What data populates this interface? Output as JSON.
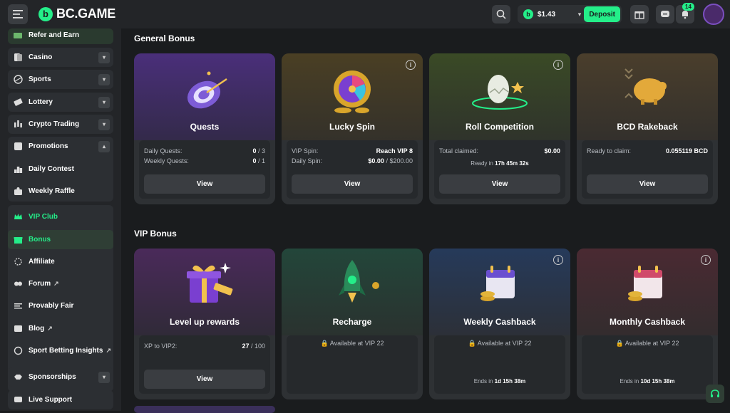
{
  "brand": {
    "name": "BC.GAME"
  },
  "header": {
    "balance": "$1.43",
    "deposit_label": "Deposit",
    "notif_count": "14"
  },
  "sidebar": {
    "items": [
      {
        "label": "Refer and Earn"
      },
      {
        "label": "Casino"
      },
      {
        "label": "Sports"
      },
      {
        "label": "Lottery"
      },
      {
        "label": "Crypto Trading"
      },
      {
        "label": "Promotions"
      },
      {
        "label": "Daily Contest"
      },
      {
        "label": "Weekly Raffle"
      },
      {
        "label": "VIP Club"
      },
      {
        "label": "Bonus"
      },
      {
        "label": "Affiliate"
      },
      {
        "label": "Forum"
      },
      {
        "label": "Provably Fair"
      },
      {
        "label": "Blog"
      },
      {
        "label": "Sport Betting Insights"
      },
      {
        "label": "Sponsorships"
      },
      {
        "label": "Live Support"
      }
    ]
  },
  "general": {
    "title": "General Bonus",
    "quests": {
      "title": "Quests",
      "row1_label": "Daily Quests:",
      "row1_value": "0",
      "row1_total": "/ 3",
      "row2_label": "Weekly Quests:",
      "row2_value": "0",
      "row2_total": "/ 1",
      "button": "View"
    },
    "lucky": {
      "title": "Lucky Spin",
      "row1_label": "VIP Spin:",
      "row1_value": "Reach VIP 8",
      "row2_label": "Daily Spin:",
      "row2_value": "$0.00",
      "row2_total": "/ $200.00",
      "button": "View"
    },
    "roll": {
      "title": "Roll Competition",
      "row1_label": "Total claimed:",
      "row1_value": "$0.00",
      "ready_label": "Ready in",
      "ready_value": "17h 45m 32s",
      "button": "View"
    },
    "rakeback": {
      "title": "BCD Rakeback",
      "row1_label": "Ready to claim:",
      "row1_value": "0.055119 BCD",
      "button": "View"
    }
  },
  "vip": {
    "title": "VIP Bonus",
    "levelup": {
      "title": "Level up rewards",
      "row1_label": "XP to VIP2:",
      "row1_value": "27",
      "row1_total": "/ 100",
      "button": "View"
    },
    "recharge": {
      "title": "Recharge",
      "locked": "Available at VIP 22"
    },
    "weekly": {
      "title": "Weekly Cashback",
      "locked": "Available at VIP 22",
      "ends_label": "Ends in",
      "ends_value": "1d 15h 38m"
    },
    "monthly": {
      "title": "Monthly Cashback",
      "locked": "Available at VIP 22",
      "ends_label": "Ends in",
      "ends_value": "10d 15h 38m"
    }
  },
  "colors": {
    "accent": "#24ee89",
    "bg": "#1a1c1e",
    "panel": "#232528",
    "card": "#2e3134"
  }
}
